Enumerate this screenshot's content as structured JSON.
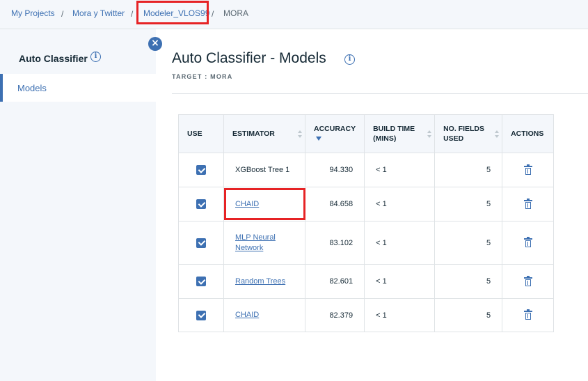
{
  "breadcrumb": {
    "items": [
      "My Projects",
      "Mora y Twitter",
      "Modeler_VLOS99",
      "MORA"
    ]
  },
  "side_panel": {
    "title": "Auto Classifier",
    "nav_item": "Models",
    "close_glyph": "×",
    "info_glyph": "i"
  },
  "main": {
    "title": "Auto Classifier - Models",
    "target_label": "TARGET : MORA",
    "info_glyph": "i"
  },
  "table": {
    "headers": {
      "use": "USE",
      "estimator": "ESTIMATOR",
      "accuracy": "ACCURACY",
      "build_time_1": "BUILD TIME",
      "build_time_2": "(MINS)",
      "fields_1": "NO. FIELDS",
      "fields_2": "USED",
      "actions": "ACTIONS"
    },
    "rows": [
      {
        "use": true,
        "estimator": "XGBoost Tree 1",
        "is_link": false,
        "accuracy": "94.330",
        "build_time": "< 1",
        "fields": "5"
      },
      {
        "use": true,
        "estimator": "CHAID",
        "is_link": true,
        "accuracy": "84.658",
        "build_time": "< 1",
        "fields": "5"
      },
      {
        "use": true,
        "estimator_line1": "MLP Neural",
        "estimator_line2": "Network",
        "is_link": true,
        "accuracy": "83.102",
        "build_time": "< 1",
        "fields": "5"
      },
      {
        "use": true,
        "estimator": "Random Trees",
        "is_link": true,
        "accuracy": "82.601",
        "build_time": "< 1",
        "fields": "5"
      },
      {
        "use": true,
        "estimator": "CHAID",
        "is_link": true,
        "accuracy": "82.379",
        "build_time": "< 1",
        "fields": "5"
      }
    ]
  },
  "colors": {
    "accent": "#3d70b2",
    "highlight": "#e62325",
    "panel_bg": "#f4f7fb"
  }
}
